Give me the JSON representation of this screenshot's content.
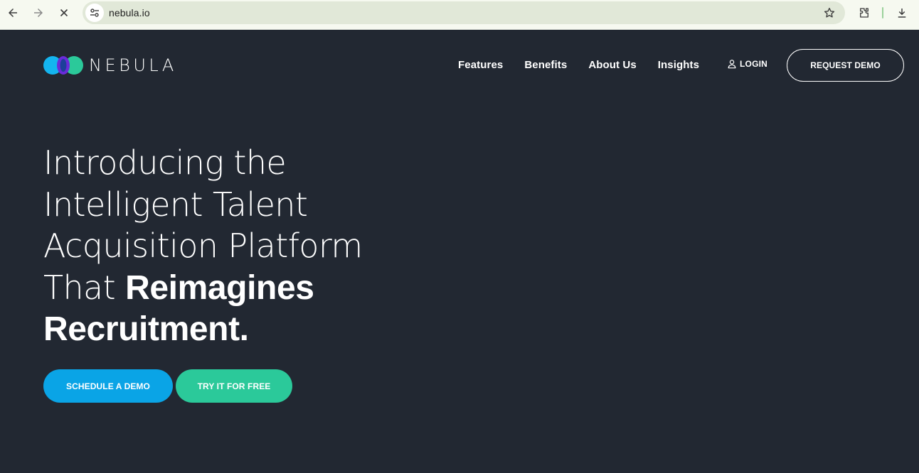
{
  "browser": {
    "url": "nebula.io"
  },
  "site": {
    "brand": "NEBULA",
    "nav": [
      "Features",
      "Benefits",
      "About Us",
      "Insights"
    ],
    "login_label": "LOGIN",
    "request_demo_label": "REQUEST DEMO"
  },
  "hero": {
    "line1": "Introducing the",
    "line2": "Intelligent Talent",
    "line3": "Acquisition Platform",
    "line4_light": "That",
    "line4_bold": "Reimagines",
    "line5_bold": "Recruitment."
  },
  "cta": {
    "schedule_label": "SCHEDULE A DEMO",
    "try_label": "TRY IT FOR FREE"
  },
  "colors": {
    "page_bg": "#222832",
    "schedule_button": "#0aa4e6",
    "try_button": "#2bc99a",
    "logo_left": "#14b4ef",
    "logo_middle": "#6a2bd9",
    "logo_right": "#2bc99a"
  },
  "icons": [
    "back-arrow-icon",
    "forward-arrow-icon",
    "close-icon",
    "site-info-icon",
    "star-icon",
    "extensions-icon",
    "download-icon",
    "user-icon"
  ]
}
